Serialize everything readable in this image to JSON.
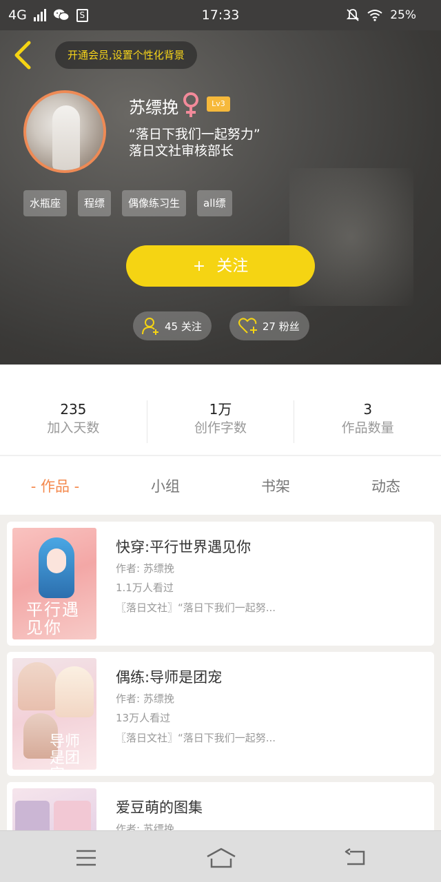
{
  "status_bar": {
    "network": "4G",
    "time": "17:33",
    "battery": "25%"
  },
  "header": {
    "vip_prompt": "开通会员,设置个性化背景",
    "username": "苏缥挽",
    "level": "Lv3",
    "bio_line1": "“落日下我们一起努力”",
    "bio_line2": "落日文社审核部长",
    "tags": [
      "水瓶座",
      "程缥",
      "偶像练习生",
      "all缥"
    ],
    "follow_label": "关注",
    "following_count": "45 关注",
    "fans_count": "27 粉丝"
  },
  "stats": [
    {
      "value": "235",
      "label": "加入天数"
    },
    {
      "value": "1万",
      "label": "创作字数"
    },
    {
      "value": "3",
      "label": "作品数量"
    }
  ],
  "tabs": [
    "- 作品 -",
    "小组",
    "书架",
    "动态"
  ],
  "works": [
    {
      "title": "快穿:平行世界遇见你",
      "author": "作者: 苏缥挽",
      "views": "1.1万人看过",
      "club": "〖落日文社〗“落日下我们一起努...",
      "cover_text": "平行遇见你"
    },
    {
      "title": "偶练:导师是团宠",
      "author": "作者: 苏缥挽",
      "views": "13万人看过",
      "club": "〖落日文社〗“落日下我们一起努...",
      "cover_text": "导师是团宠"
    },
    {
      "title": "爱豆萌的图集",
      "author": "作者: 苏缥挽"
    }
  ],
  "colors": {
    "accent_yellow": "#f5d413",
    "tab_active": "#f4884c",
    "avatar_ring": "#ee8a55",
    "level_badge": "#f6b93b"
  },
  "icons": {
    "back": "chevron-left-icon",
    "gender": "female-symbol-icon",
    "following": "person-plus-icon",
    "fans": "heart-plus-icon",
    "nav_menu": "menu-icon",
    "nav_home": "home-icon",
    "nav_back": "back-arrow-icon"
  }
}
